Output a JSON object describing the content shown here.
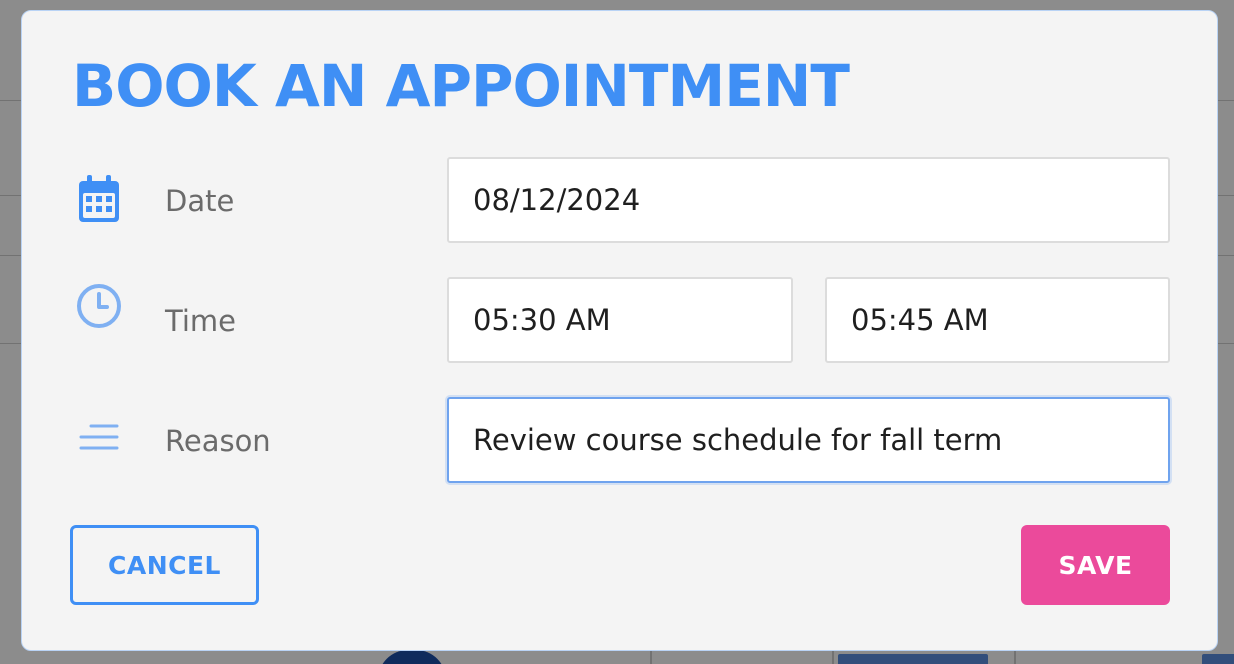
{
  "modal": {
    "title": "BOOK AN APPOINTMENT",
    "rows": {
      "date": {
        "label": "Date",
        "icon": "calendar-icon",
        "value": "08/12/2024"
      },
      "time": {
        "label": "Time",
        "icon": "clock-icon",
        "start_value": "05:30 AM",
        "end_value": "05:45 AM"
      },
      "reason": {
        "label": "Reason",
        "icon": "lines-icon",
        "value": "Review course schedule for fall term"
      }
    },
    "buttons": {
      "cancel_label": "CANCEL",
      "save_label": "SAVE"
    }
  },
  "colors": {
    "accent_blue": "#3f8ff5",
    "save_pink": "#eb4a9b",
    "modal_bg": "#f4f4f4",
    "label_gray": "#6b6b6b",
    "focus_border": "#6fa3ee"
  }
}
